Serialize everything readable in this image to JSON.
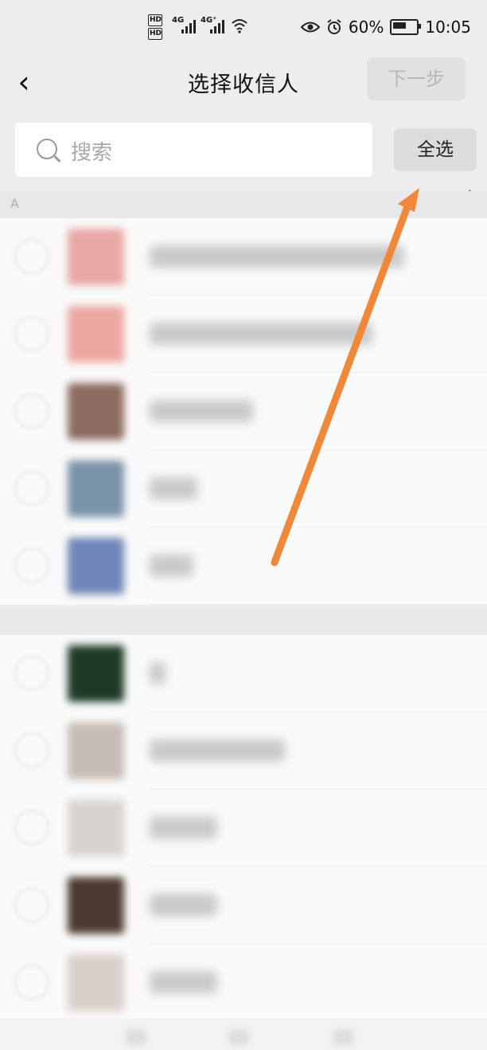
{
  "status_bar": {
    "hd1": "HD",
    "hd2": "HD",
    "sig1": "4G",
    "sig2": "4G⁺",
    "battery_pct": "60%",
    "time": "10:05",
    "icons": [
      "eye-icon",
      "alarm-icon",
      "wifi-icon",
      "battery-icon"
    ]
  },
  "header": {
    "back_icon": "‹",
    "title": "选择收信人",
    "next_label": "下一步"
  },
  "search": {
    "placeholder": "搜索",
    "select_all": "全选"
  },
  "index": {
    "up": "↑"
  },
  "sections": [
    {
      "letter": "A",
      "contacts": [
        {
          "avatar_color": "#e9a7a3"
        },
        {
          "avatar_color": "#eba7a2"
        },
        {
          "avatar_color": "#8c6b60"
        },
        {
          "avatar_color": "#7a93a8"
        },
        {
          "avatar_color": "#6f86b8"
        }
      ]
    },
    {
      "letter": "",
      "contacts": [
        {
          "avatar_color": "#1f3a25"
        },
        {
          "avatar_color": "#c7bcb4"
        },
        {
          "avatar_color": "#d8d3cf"
        },
        {
          "avatar_color": "#4c3a32"
        },
        {
          "avatar_color": "#d9cfca"
        }
      ]
    }
  ],
  "colors": {
    "accent_arrow": "#f0883a",
    "background": "#ededed"
  }
}
